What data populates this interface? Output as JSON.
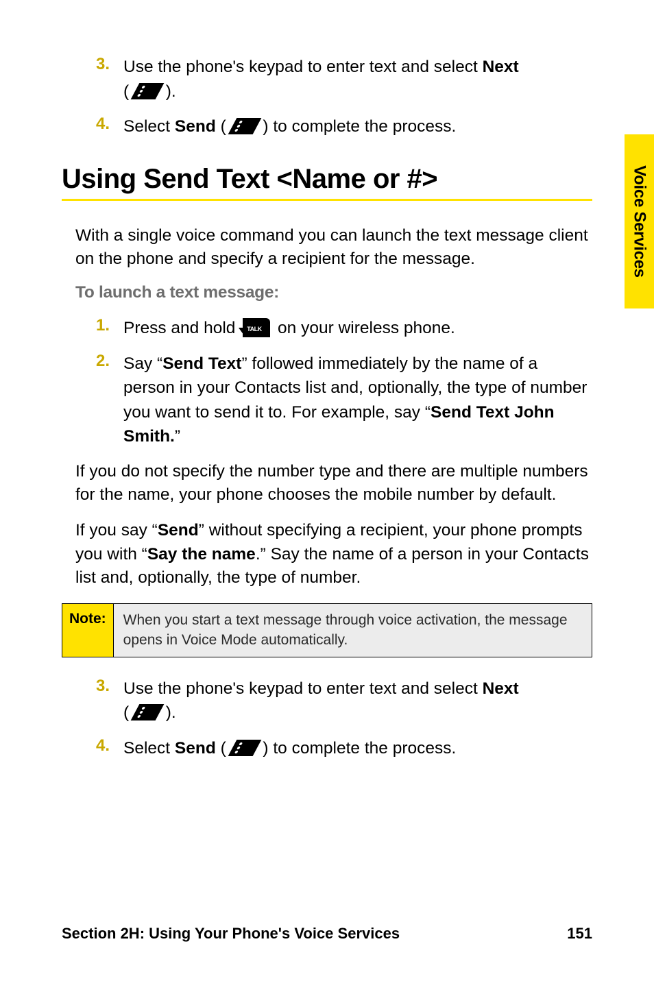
{
  "top_steps": [
    {
      "num": "3.",
      "pre": "Use the phone's keypad to enter text and select ",
      "bold": "Next",
      "post_open": " ( ",
      "post_close": " )."
    },
    {
      "num": "4.",
      "pre": "Select ",
      "bold": "Send",
      "post_open": " ( ",
      "post_close": " ) to complete the process."
    }
  ],
  "heading": "Using Send Text <Name or #>",
  "intro": "With a single voice command you can launch the text message client on the phone and specify a recipient for the message.",
  "sub": "To launch a text message:",
  "steps_b": [
    {
      "num": "1.",
      "pre": "Press and hold ",
      "post": " on your wireless phone."
    },
    {
      "num": "2.",
      "t1": "Say “",
      "b1": "Send Text",
      "t2": "” followed immediately by the name of a person in your Contacts list and, optionally, the type of number you want to send it to. For example, say “",
      "b2": "Send Text John Smith.",
      "t3": "”"
    }
  ],
  "para1": "If you do not specify the number type and there are multiple numbers for the name, your phone chooses the mobile number by default.",
  "para2_a": "If you say “",
  "para2_b1": "Send",
  "para2_b": "” without specifying a recipient, your phone prompts you with “",
  "para2_b2": "Say the name",
  "para2_c": ".” Say the name of a person in your Contacts list and, optionally, the type of number.",
  "note_label": "Note:",
  "note_text": "When you start a text message through voice activation, the message opens in Voice Mode automatically.",
  "bottom_steps": [
    {
      "num": "3.",
      "pre": "Use the phone's keypad to enter text and select ",
      "bold": "Next",
      "post_open": " ( ",
      "post_close": " )."
    },
    {
      "num": "4.",
      "pre": "Select ",
      "bold": "Send",
      "post_open": " ( ",
      "post_close": " ) to complete the process."
    }
  ],
  "side_tab": "Voice Services",
  "footer_section": "Section 2H: Using Your Phone's Voice Services",
  "footer_page": "151"
}
